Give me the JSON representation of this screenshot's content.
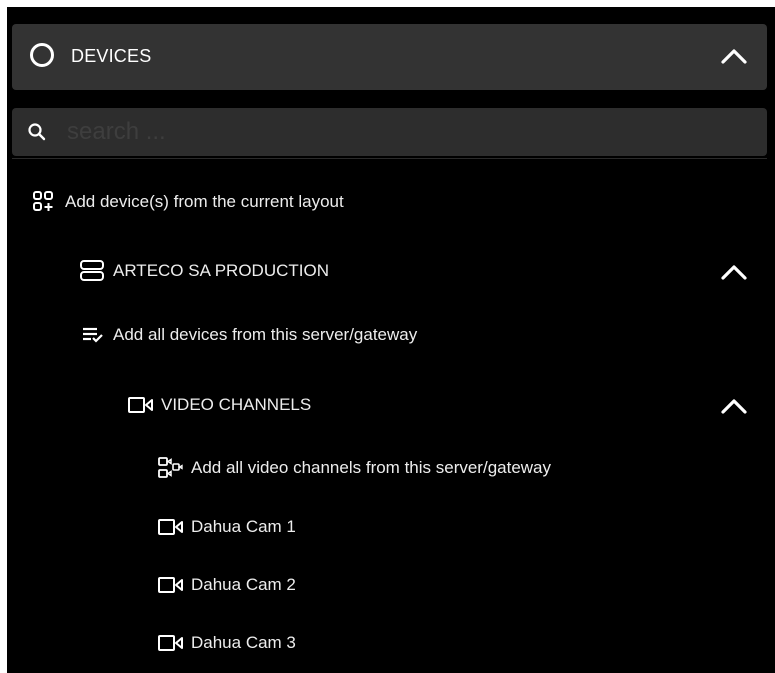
{
  "header": {
    "title": "DEVICES",
    "icon": "circle-icon",
    "toggle_icon": "chevron-up-icon"
  },
  "search": {
    "placeholder": "search ...",
    "value": "",
    "icon": "search-icon"
  },
  "tree": {
    "add_from_layout": {
      "label": "Add device(s) from the current layout",
      "icon": "add-devices-grid-icon"
    },
    "server": {
      "label": "ARTECO SA PRODUCTION",
      "icon": "server-icon",
      "toggle_icon": "chevron-up-icon",
      "add_all": {
        "label": "Add all devices from this server/gateway",
        "icon": "playlist-add-check-icon"
      },
      "video_channels": {
        "label": "VIDEO CHANNELS",
        "icon": "video-camera-icon",
        "toggle_icon": "chevron-up-icon",
        "add_all": {
          "label": "Add all video channels from this server/gateway",
          "icon": "add-video-channels-icon"
        },
        "cameras": [
          {
            "label": "Dahua Cam 1",
            "icon": "video-camera-icon"
          },
          {
            "label": "Dahua Cam 2",
            "icon": "video-camera-icon"
          },
          {
            "label": "Dahua Cam 3",
            "icon": "video-camera-icon"
          }
        ]
      }
    }
  },
  "colors": {
    "background": "#000000",
    "header_background": "#333333",
    "search_background": "#2d2d2d",
    "text": "#ededed"
  }
}
